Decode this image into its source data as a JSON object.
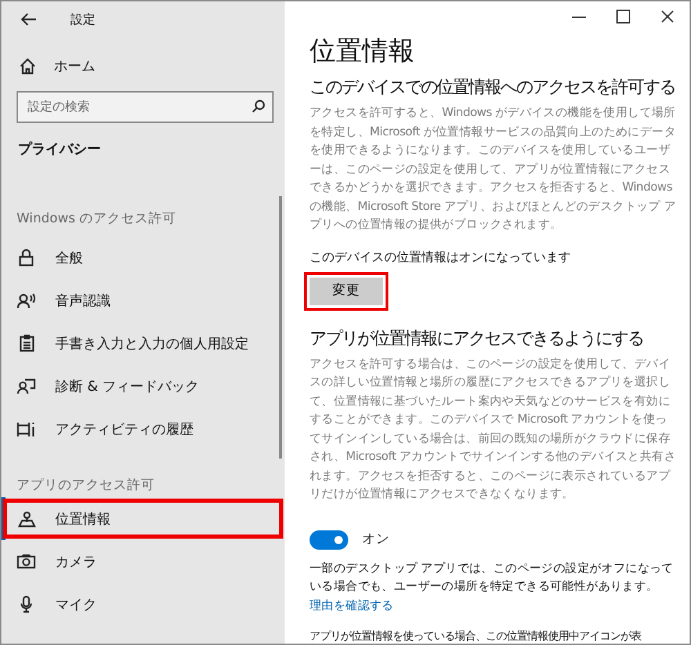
{
  "window": {
    "title": "設定"
  },
  "sidebar": {
    "home": "ホーム",
    "search": {
      "placeholder": "設定の検索"
    },
    "category": "プライバシー",
    "groups": [
      {
        "heading": "Windows のアクセス許可",
        "items": [
          {
            "label": "全般",
            "selected": false,
            "highlighted": false
          },
          {
            "label": "音声認識",
            "selected": false,
            "highlighted": false
          },
          {
            "label": "手書き入力と入力の個人用設定",
            "selected": false,
            "highlighted": false
          },
          {
            "label": "診断 & フィードバック",
            "selected": false,
            "highlighted": false
          },
          {
            "label": "アクティビティの履歴",
            "selected": false,
            "highlighted": false
          }
        ]
      },
      {
        "heading": "アプリのアクセス許可",
        "items": [
          {
            "label": "位置情報",
            "selected": true,
            "highlighted": true
          },
          {
            "label": "カメラ",
            "selected": false,
            "highlighted": false
          },
          {
            "label": "マイク",
            "selected": false,
            "highlighted": false
          }
        ]
      }
    ]
  },
  "content": {
    "title": "位置情報",
    "device_section": {
      "heading": "このデバイスでの位置情報へのアクセスを許可する",
      "description": "アクセスを許可すると、Windows がデバイスの機能を使用して場所を特定し、Microsoft が位置情報サービスの品質向上のためにデータを使用できるようになります。このデバイスを使用しているユーザーは、このページの設定を使用して、アプリが位置情報にアクセスできるかどうかを選択できます。アクセスを拒否すると、Windows の機能、Microsoft Store アプリ、およびほとんどのデスクトップ アプリへの位置情報の提供がブロックされます。",
      "status": "このデバイスの位置情報はオンになっています",
      "button": {
        "label": "変更",
        "highlighted": true
      }
    },
    "app_section": {
      "heading": "アプリが位置情報にアクセスできるようにする",
      "description": "アクセスを許可する場合は、このページの設定を使用して、デバイスの詳しい位置情報と場所の履歴にアクセスできるアプリを選択して、位置情報に基づいたルート案内や天気などのサービスを有効にすることができます。このデバイスで Microsoft アカウントを使ってサインインしている場合は、前回の既知の場所がクラウドに保存され、Microsoft アカウントでサインインする他のデバイスと共有されます。アクセスを拒否すると、このページに表示されているアプリだけが位置情報にアクセスできなくなります。",
      "toggle": {
        "on": true,
        "label": "オン"
      },
      "note": "一部のデスクトップ アプリでは、このページの設定がオフになっている場合でも、ユーザーの場所を特定できる可能性があります。",
      "note_link": "理由を確認する",
      "footer": "アプリが位置情報を使っている場合、この位置情報使用中アイコンが表"
    }
  }
}
